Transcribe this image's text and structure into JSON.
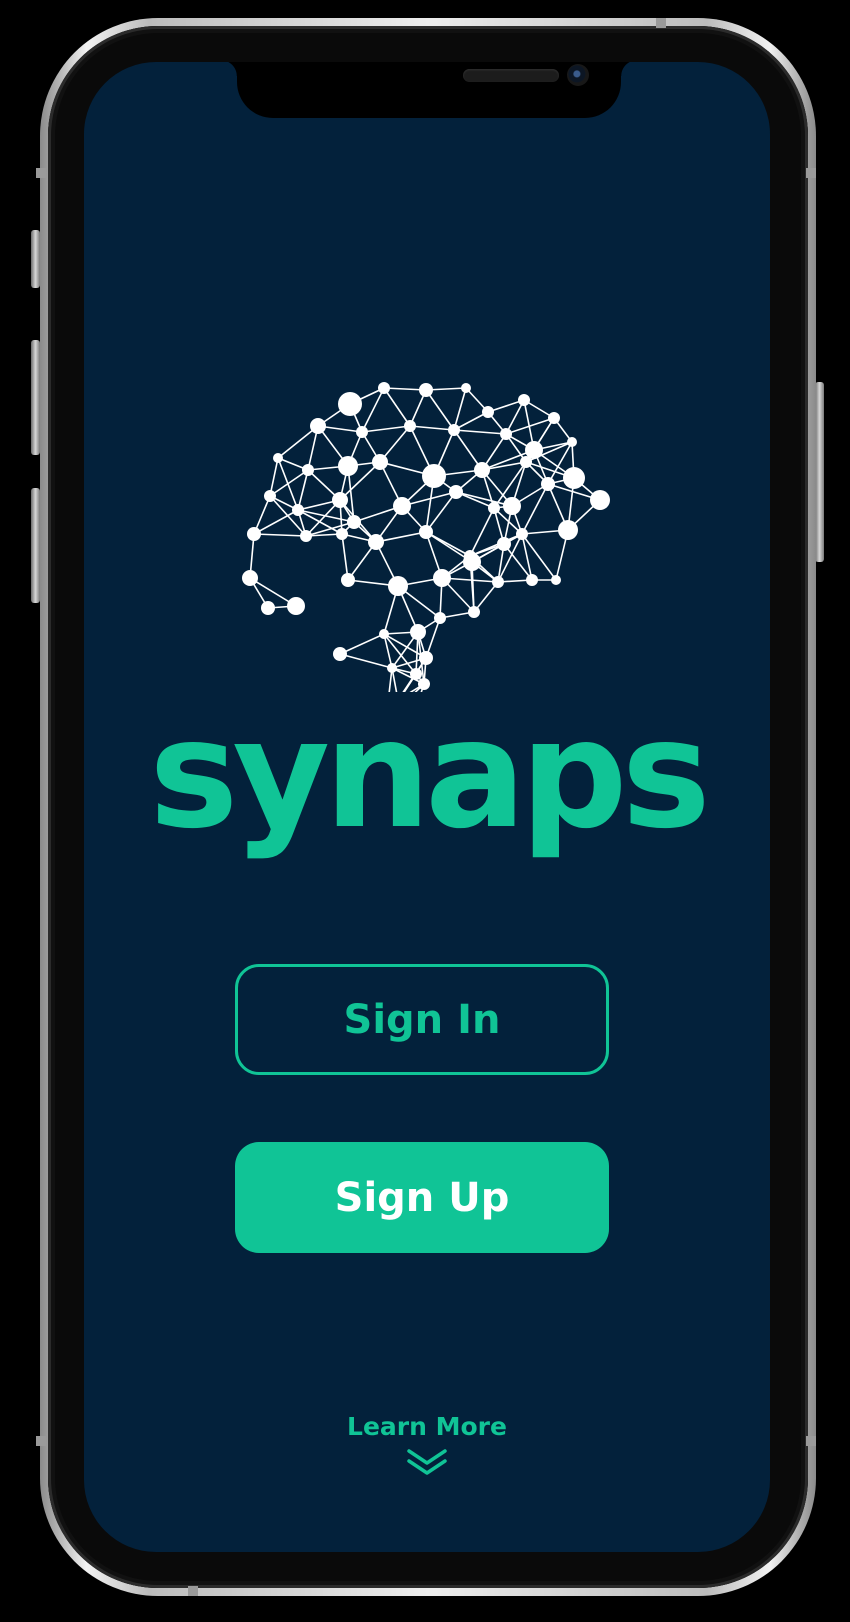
{
  "app": {
    "brand_name": "synaps",
    "logo_icon": "brain-network-icon"
  },
  "actions": {
    "sign_in_label": "Sign In",
    "sign_up_label": "Sign Up",
    "learn_more_label": "Learn More",
    "learn_more_icon": "double-chevron-down-icon"
  },
  "colors": {
    "background": "#03213b",
    "accent": "#10c496",
    "logo": "#ffffff",
    "frame": "#000000"
  }
}
